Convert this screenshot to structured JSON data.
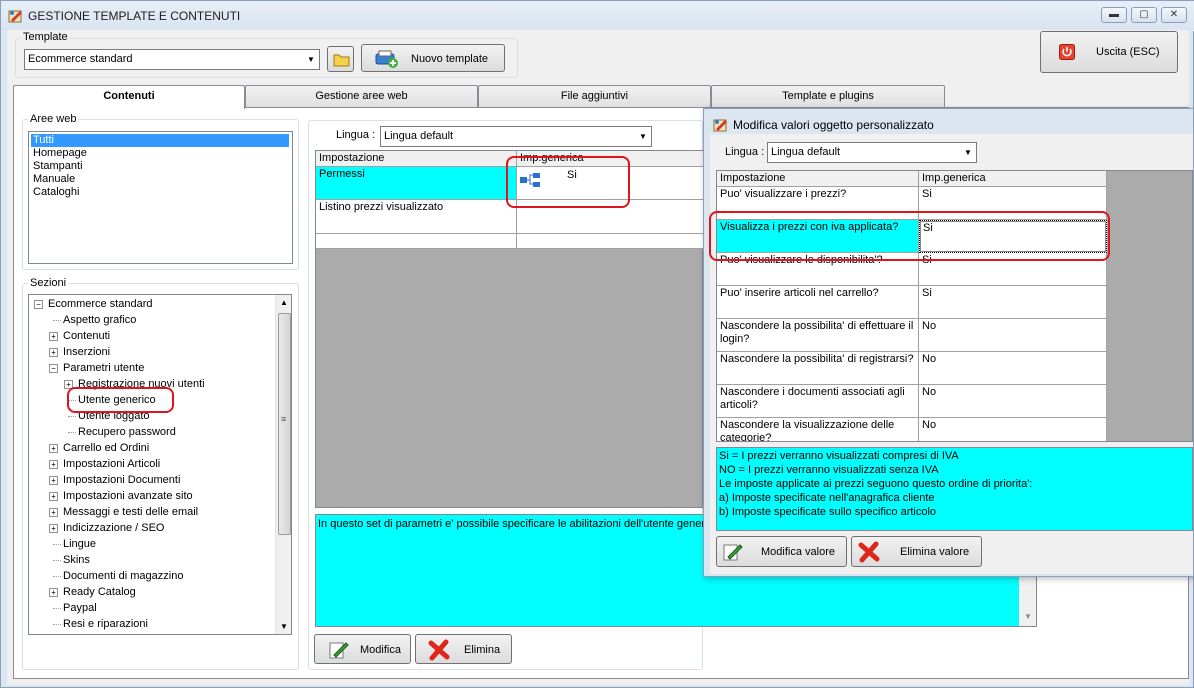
{
  "window": {
    "title": "GESTIONE TEMPLATE E CONTENUTI",
    "minimize": "▬",
    "maximize": "▢",
    "close": "✕"
  },
  "template": {
    "label": "Template",
    "selected": "Ecommerce standard",
    "new_button": "Nuovo template"
  },
  "exit_button": "Uscita (ESC)",
  "tabs": [
    {
      "label": "Contenuti",
      "active": true
    },
    {
      "label": "Gestione aree web",
      "active": false
    },
    {
      "label": "File aggiuntivi",
      "active": false
    },
    {
      "label": "Template e plugins",
      "active": false
    }
  ],
  "aree_web": {
    "label": "Aree web",
    "items": [
      "Tutti",
      "Homepage",
      "Stampanti",
      "Manuale",
      "Cataloghi"
    ]
  },
  "sezioni": {
    "label": "Sezioni",
    "items": [
      {
        "label": "Ecommerce standard",
        "exp": "−"
      },
      {
        "label": "Aspetto grafico",
        "exp": ""
      },
      {
        "label": "Contenuti",
        "exp": "+"
      },
      {
        "label": "Inserzioni",
        "exp": "+"
      },
      {
        "label": "Parametri utente",
        "exp": "−"
      },
      {
        "label": "Registrazione nuovi utenti",
        "exp": "+"
      },
      {
        "label": "Utente generico",
        "exp": ""
      },
      {
        "label": "Utente loggato",
        "exp": ""
      },
      {
        "label": "Recupero password",
        "exp": ""
      },
      {
        "label": "Carrello ed Ordini",
        "exp": "+"
      },
      {
        "label": "Impostazioni Articoli",
        "exp": "+"
      },
      {
        "label": "Impostazioni Documenti",
        "exp": "+"
      },
      {
        "label": "Impostazioni avanzate sito",
        "exp": "+"
      },
      {
        "label": "Messaggi e testi delle email",
        "exp": "+"
      },
      {
        "label": "Indicizzazione / SEO",
        "exp": "+"
      },
      {
        "label": "Lingue",
        "exp": ""
      },
      {
        "label": "Skins",
        "exp": ""
      },
      {
        "label": "Documenti di magazzino",
        "exp": ""
      },
      {
        "label": "Ready Catalog",
        "exp": "+"
      },
      {
        "label": "Paypal",
        "exp": ""
      },
      {
        "label": "Resi e riparazioni",
        "exp": ""
      }
    ]
  },
  "main_grid": {
    "lingua_label": "Lingua :",
    "lingua_value": "Lingua default",
    "headers": [
      "Impostazione",
      "Imp.generica"
    ],
    "rows": [
      {
        "name": "Permessi",
        "value": "Si"
      },
      {
        "name": "Listino prezzi visualizzato",
        "value": ""
      }
    ],
    "description": "In questo set di parametri e' possibile specificare le abilitazioni dell'utente generico",
    "modify_button": "Modifica",
    "delete_button": "Elimina"
  },
  "dialog": {
    "title": "Modifica valori oggetto personalizzato",
    "lingua_label": "Lingua :",
    "lingua_value": "Lingua default",
    "headers": [
      "Impostazione",
      "Imp.generica"
    ],
    "rows": [
      {
        "name": "Puo' visualizzare i prezzi?",
        "value": "Si"
      },
      {
        "name": "Visualizza i prezzi con iva applicata?",
        "value": "Si"
      },
      {
        "name": "Puo' visualizzare le disponibilita'?",
        "value": "Si"
      },
      {
        "name": "Puo' inserire articoli nel carrello?",
        "value": "Si"
      },
      {
        "name": "Nascondere la possibilita' di effettuare il login?",
        "value": "No"
      },
      {
        "name": "Nascondere la possibilita' di registrarsi?",
        "value": "No"
      },
      {
        "name": "Nascondere i documenti associati agli articoli?",
        "value": "No"
      },
      {
        "name": "Nascondere la visualizzazione delle categorie?",
        "value": "No"
      }
    ],
    "info_lines": [
      "Si = I prezzi verranno visualizzati compresi di IVA",
      "NO = I prezzi verranno visualizzati senza IVA",
      "Le imposte applicate ai prezzi seguono questo ordine di priorita':",
      "a) Imposte specificate nell'anagrafica cliente",
      "b) Imposte specificate sullo specifico articolo"
    ],
    "modify_button": "Modifica valore",
    "delete_button": "Elimina valore"
  },
  "colors": {
    "highlight": "#00ffff",
    "selection": "#3399ff",
    "annotation": "#e0141e"
  }
}
